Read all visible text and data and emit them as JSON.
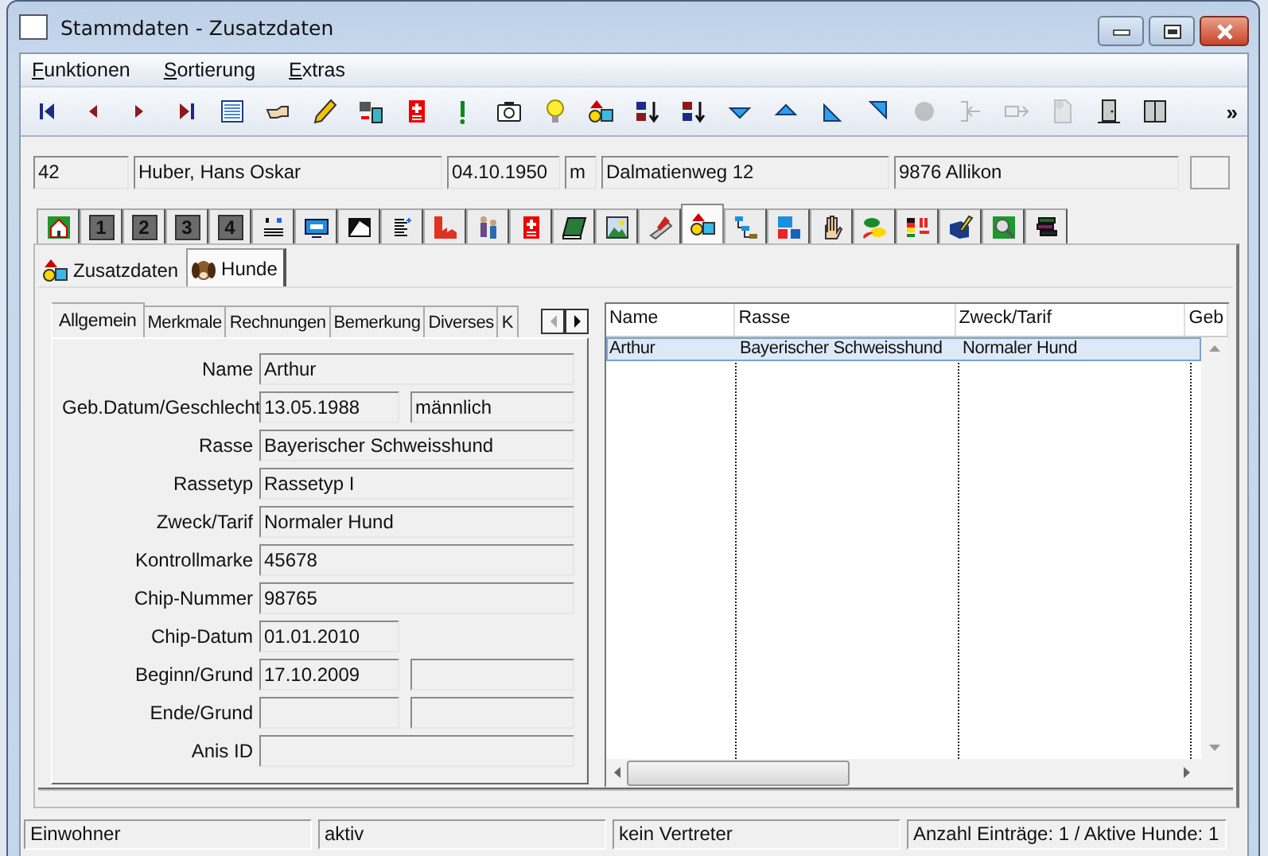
{
  "window": {
    "title": "Stammdaten - Zusatzdaten"
  },
  "menu": [
    "Funktionen",
    "Sortierung",
    "Extras"
  ],
  "toolbar": {
    "buttons": [
      {
        "disabled": false
      },
      {
        "disabled": false
      },
      {
        "disabled": false
      },
      {
        "disabled": false
      },
      {
        "disabled": false
      },
      {
        "disabled": false
      },
      {
        "disabled": false
      },
      {
        "disabled": false
      },
      {
        "disabled": false
      },
      {
        "disabled": false
      },
      {
        "disabled": false
      },
      {
        "disabled": false
      },
      {
        "disabled": false
      },
      {
        "disabled": false
      },
      {
        "disabled": false
      },
      {
        "disabled": false
      },
      {
        "disabled": false
      },
      {
        "disabled": false
      },
      {
        "disabled": false
      },
      {
        "disabled": true
      },
      {
        "disabled": true
      },
      {
        "disabled": true
      },
      {
        "disabled": true
      },
      {
        "disabled": false
      },
      {
        "disabled": false
      }
    ],
    "overflow": "»"
  },
  "header_fields": [
    "42",
    "Huber, Hans Oskar",
    "04.10.1950",
    "m",
    "Dalmatienweg 12",
    "9876 Allikon"
  ],
  "module_tabs": [
    {
      "selected": false
    },
    {
      "label": "1",
      "selected": false
    },
    {
      "label": "2",
      "selected": false
    },
    {
      "label": "3",
      "selected": false
    },
    {
      "label": "4",
      "selected": false
    },
    {
      "selected": false
    },
    {
      "selected": false
    },
    {
      "selected": false
    },
    {
      "selected": false
    },
    {
      "selected": false
    },
    {
      "selected": false
    },
    {
      "selected": false
    },
    {
      "selected": false
    },
    {
      "selected": false
    },
    {
      "selected": false
    },
    {
      "selected": true
    },
    {
      "selected": false
    },
    {
      "selected": false
    },
    {
      "selected": false
    },
    {
      "selected": false
    },
    {
      "selected": false
    },
    {
      "selected": false
    },
    {
      "selected": false
    },
    {
      "selected": false
    }
  ],
  "sub_tabs": [
    {
      "label": "Zusatzdaten",
      "selected": false
    },
    {
      "label": "Hunde",
      "selected": true
    }
  ],
  "detail_tabs": [
    {
      "label": "Allgemein",
      "selected": true
    },
    {
      "label": "Merkmale",
      "selected": false
    },
    {
      "label": "Rechnungen",
      "selected": false
    },
    {
      "label": "Bemerkung",
      "selected": false
    },
    {
      "label": "Diverses",
      "selected": false
    },
    {
      "label": "K",
      "selected": false
    }
  ],
  "form": [
    {
      "label": "Name",
      "kind": "full",
      "values": [
        "Arthur"
      ]
    },
    {
      "label": "Geb.Datum/Geschlecht",
      "kind": "pair",
      "values": [
        "13.05.1988",
        "männlich"
      ]
    },
    {
      "label": "Rasse",
      "kind": "full",
      "values": [
        "Bayerischer Schweisshund"
      ]
    },
    {
      "label": "Rassetyp",
      "kind": "full",
      "values": [
        "Rassetyp I"
      ]
    },
    {
      "label": "Zweck/Tarif",
      "kind": "full",
      "values": [
        "Normaler Hund"
      ]
    },
    {
      "label": "Kontrollmarke",
      "kind": "full",
      "values": [
        "45678"
      ]
    },
    {
      "label": "Chip-Nummer",
      "kind": "full",
      "values": [
        "98765"
      ]
    },
    {
      "label": "Chip-Datum",
      "kind": "short",
      "values": [
        "01.01.2010"
      ]
    },
    {
      "label": "Beginn/Grund",
      "kind": "pair",
      "values": [
        "17.10.2009"
      ]
    },
    {
      "label": "Ende/Grund",
      "kind": "pair"
    },
    {
      "label": "Anis ID",
      "kind": "full"
    }
  ],
  "table": {
    "columns": [
      "Name",
      "Rasse",
      "Zweck/Tarif",
      "Geb"
    ],
    "rows": [
      {
        "cells": [
          "Arthur",
          "Bayerischer Schweisshund",
          "Normaler Hund"
        ],
        "selected": true
      }
    ]
  },
  "status_bar": [
    "Einwohner",
    "aktiv",
    "kein Vertreter",
    "Anzahl Einträge: 1 / Aktive Hunde: 1"
  ]
}
